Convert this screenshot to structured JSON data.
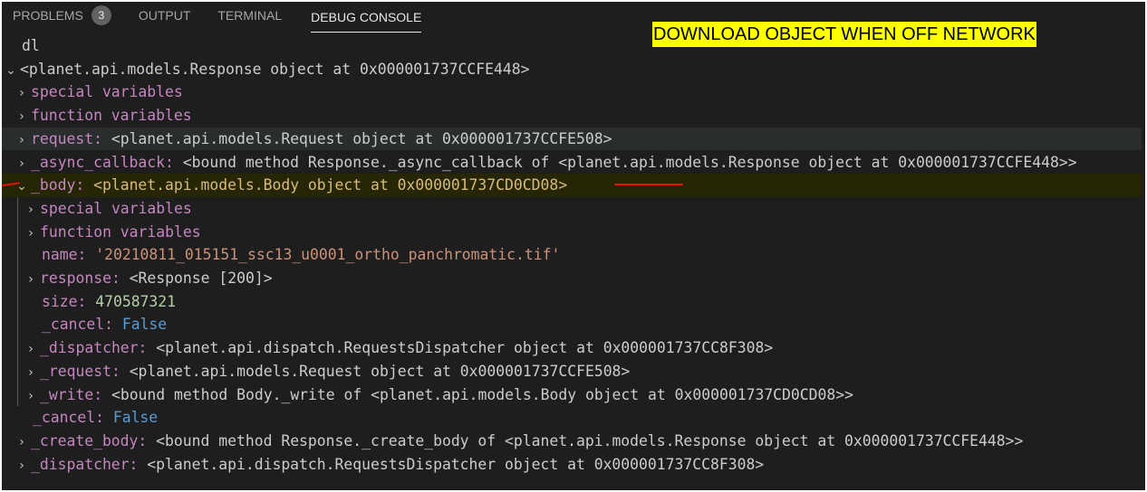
{
  "tabs": [
    {
      "label": "PROBLEMS",
      "badge": "3"
    },
    {
      "label": "OUTPUT"
    },
    {
      "label": "TERMINAL"
    },
    {
      "label": "DEBUG CONSOLE"
    }
  ],
  "banner": "DOWNLOAD OBJECT WHEN OFF NETWORK",
  "console": {
    "input": "dl",
    "root": "<planet.api.models.Response object at 0x000001737CCFE448>",
    "lines": [
      {
        "key": "special variables",
        "val": ""
      },
      {
        "key": "function variables",
        "val": ""
      },
      {
        "key": "request:",
        "val": "<planet.api.models.Request object at 0x000001737CCFE508>"
      },
      {
        "key": "_async_callback:",
        "val": "<bound method Response._async_callback of <planet.api.models.Response object at 0x000001737CCFE448>>"
      },
      {
        "key": "_body:",
        "val": "<planet.api.models.Body object at 0x000001737CD0CD08>"
      },
      {
        "key": "special variables",
        "val": ""
      },
      {
        "key": "function variables",
        "val": ""
      },
      {
        "key": "name:",
        "val": "'20210811_015151_ssc13_u0001_ortho_panchromatic.tif'"
      },
      {
        "key": "response:",
        "val": "<Response [200]>"
      },
      {
        "key": "size:",
        "val": "470587321"
      },
      {
        "key": "_cancel:",
        "val": "False"
      },
      {
        "key": "_dispatcher:",
        "val": "<planet.api.dispatch.RequestsDispatcher object at 0x000001737CC8F308>"
      },
      {
        "key": "_request:",
        "val": "<planet.api.models.Request object at 0x000001737CCFE508>"
      },
      {
        "key": "_write:",
        "val": "<bound method Body._write of <planet.api.models.Body object at 0x000001737CD0CD08>>"
      },
      {
        "key": "_cancel:",
        "val": "False"
      },
      {
        "key": "_create_body:",
        "val": "<bound method Response._create_body of <planet.api.models.Response object at 0x000001737CCFE448>>"
      },
      {
        "key": "_dispatcher:",
        "val": "<planet.api.dispatch.RequestsDispatcher object at 0x000001737CC8F308>"
      }
    ]
  }
}
